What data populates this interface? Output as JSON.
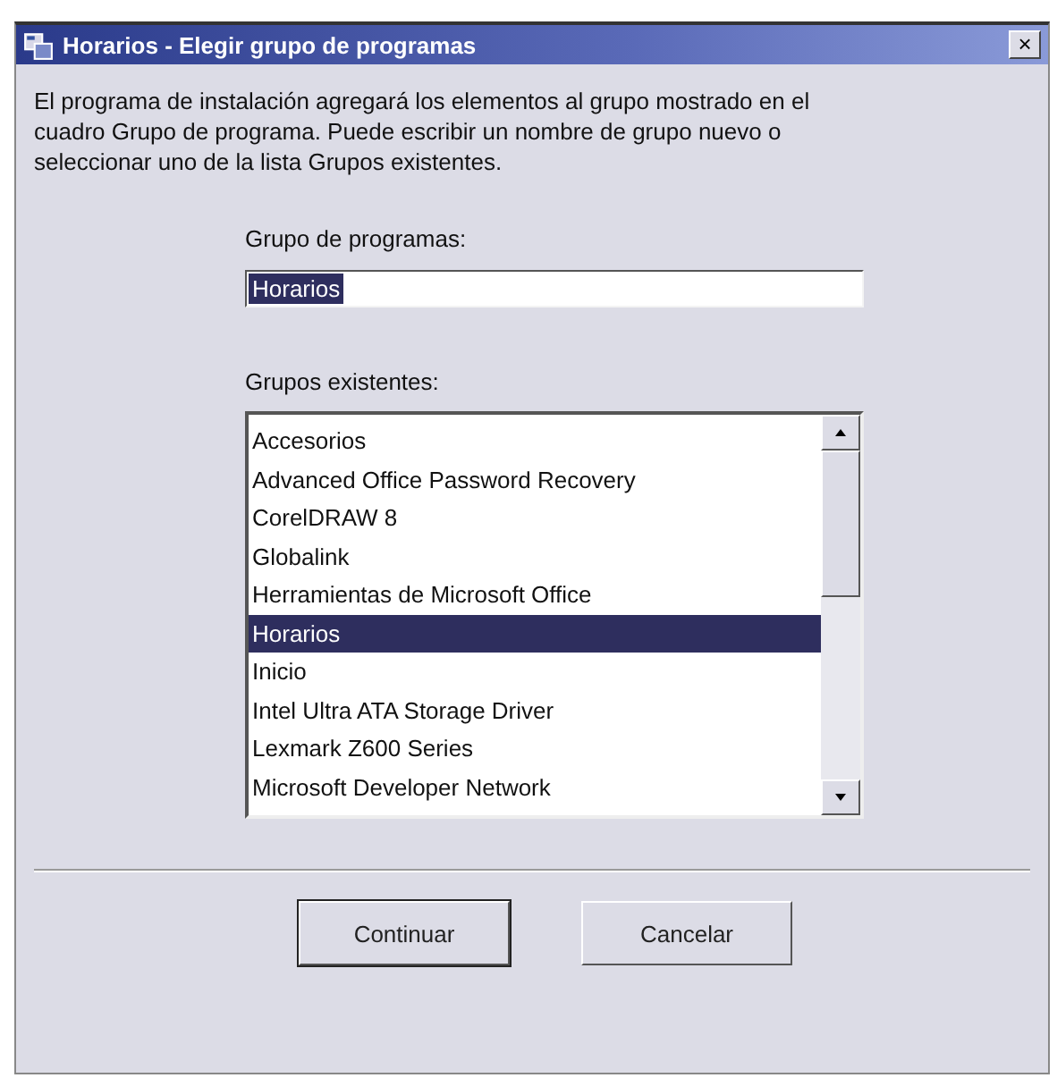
{
  "window": {
    "title": "Horarios - Elegir grupo de programas",
    "close": "×"
  },
  "description": "El programa de instalación agregará los elementos al grupo mostrado en el cuadro Grupo de programa. Puede escribir un nombre de grupo nuevo o seleccionar uno de la lista Grupos existentes.",
  "group_field": {
    "label": "Grupo de programas:",
    "value": "Horarios",
    "selected": true
  },
  "groups_list": {
    "label": "Grupos existentes:",
    "items": [
      {
        "label": "Accesorios",
        "selected": false
      },
      {
        "label": "Advanced Office Password Recovery",
        "selected": false
      },
      {
        "label": "CorelDRAW 8",
        "selected": false
      },
      {
        "label": "Globalink",
        "selected": false
      },
      {
        "label": "Herramientas de Microsoft Office",
        "selected": false
      },
      {
        "label": "Horarios",
        "selected": true
      },
      {
        "label": "Inicio",
        "selected": false
      },
      {
        "label": "Intel Ultra ATA Storage Driver",
        "selected": false
      },
      {
        "label": "Lexmark Z600 Series",
        "selected": false
      },
      {
        "label": "Microsoft Developer Network",
        "selected": false
      }
    ]
  },
  "buttons": [
    {
      "label": "Continuar",
      "default": true
    },
    {
      "label": "Cancelar",
      "default": false
    }
  ]
}
